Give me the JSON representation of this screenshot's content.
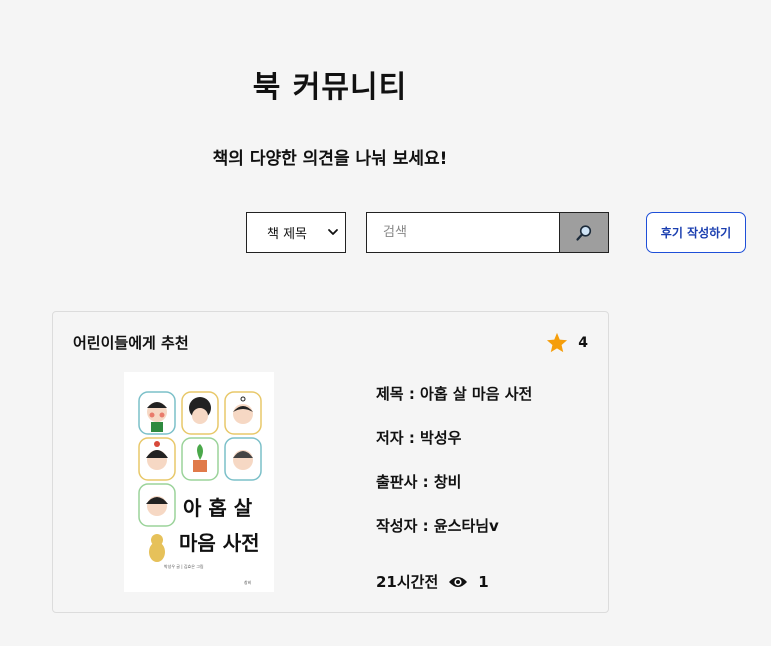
{
  "header": {
    "title": "북 커뮤니티",
    "subtitle": "책의 다양한 의견을 나눠 보세요!"
  },
  "search": {
    "filter_selected": "책 제목",
    "placeholder": "검색"
  },
  "actions": {
    "write_review_label": "후기 작성하기"
  },
  "icons": {
    "filter_dropdown": "chevron-down-icon",
    "search": "search-icon",
    "rating": "star-icon",
    "views": "eye-icon"
  },
  "colors": {
    "accent": "#1e4fd8",
    "star": "#f59e0b",
    "search_button": "#9e9e9e"
  },
  "card": {
    "title": "어린이들에게 추천",
    "rating": "4",
    "book_title": "제목 : 아홉 살 마음 사전",
    "author": "저자 : 박성우",
    "publisher": "출판사 : 창비",
    "writer": "작성자 : 윤스타님v",
    "time": "21시간전",
    "views": "1",
    "cover": {
      "title_line1": "아 홉 살",
      "title_line2": "마음 사전",
      "credit": "박성우 글 | 김효은 그림",
      "publisher_mark": "창비"
    }
  }
}
